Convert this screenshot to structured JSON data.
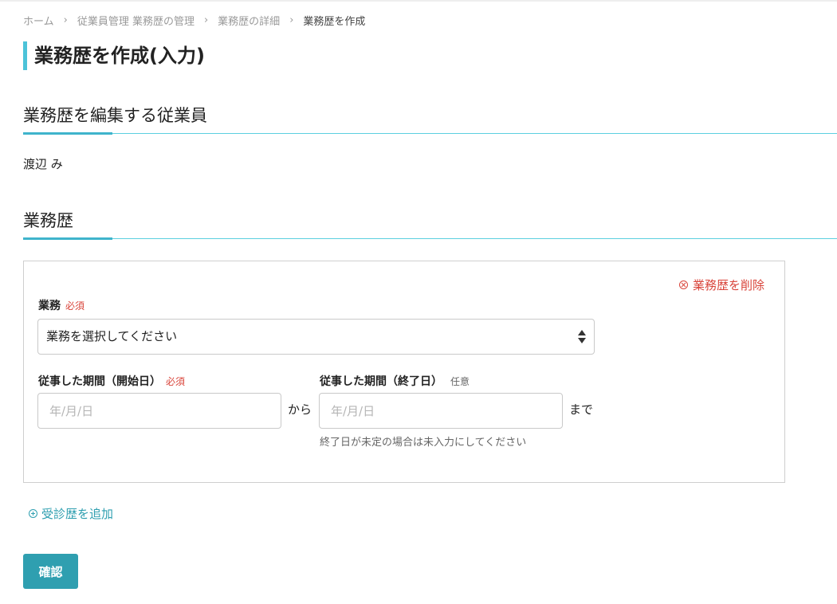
{
  "breadcrumb": {
    "items": [
      "ホーム",
      "従業員管理 業務歴の管理",
      "業務歴の詳細",
      "業務歴を作成"
    ],
    "separator": "›"
  },
  "page_title": "業務歴を作成(入力)",
  "section_employee": {
    "heading": "業務歴を編集する従業員",
    "employee_name": "渡辺 み"
  },
  "section_history": {
    "heading": "業務歴",
    "card": {
      "delete_label": "業務歴を削除",
      "job_field": {
        "label": "業務",
        "required_badge": "必須",
        "selected_value": "業務を選択してください"
      },
      "start_field": {
        "label": "従事した期間（開始日）",
        "required_badge": "必須",
        "placeholder": "年/月/日"
      },
      "from_text": "から",
      "end_field": {
        "label": "従事した期間（終了日）",
        "optional_badge": "任意",
        "placeholder": "年/月/日"
      },
      "until_text": "まで",
      "end_hint": "終了日が未定の場合は未入力にしてください"
    }
  },
  "add_link_label": "受診歴を追加",
  "confirm_button_label": "確認",
  "colors": {
    "accent": "#4cc3d9",
    "primary_button": "#2f9fb0",
    "danger": "#d9453b"
  }
}
